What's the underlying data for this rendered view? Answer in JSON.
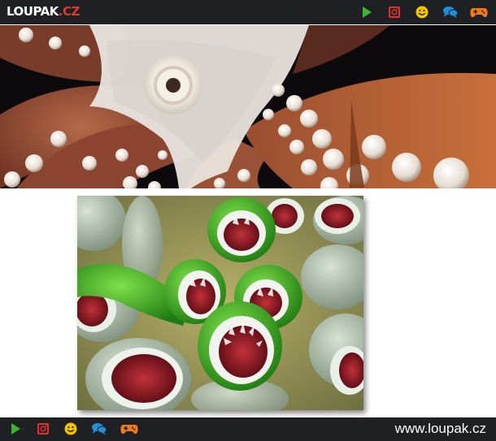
{
  "header": {
    "logo_main": "LOUPAK",
    "logo_tld": ".CZ",
    "icons": [
      "play-icon",
      "instagram-icon",
      "smiley-icon",
      "chat-icon",
      "gamepad-icon"
    ]
  },
  "footer": {
    "url": "www.loupak.cz",
    "icons": [
      "play-icon",
      "instagram-icon",
      "smiley-icon",
      "chat-icon",
      "gamepad-icon"
    ]
  },
  "colors": {
    "bar": "#1f2023",
    "play": "#3db52f",
    "instagram": "#e0312f",
    "smiley": "#f5c400",
    "chat": "#1e8fd8",
    "gamepad": "#f07a16",
    "logo_accent": "#e03a2f"
  }
}
